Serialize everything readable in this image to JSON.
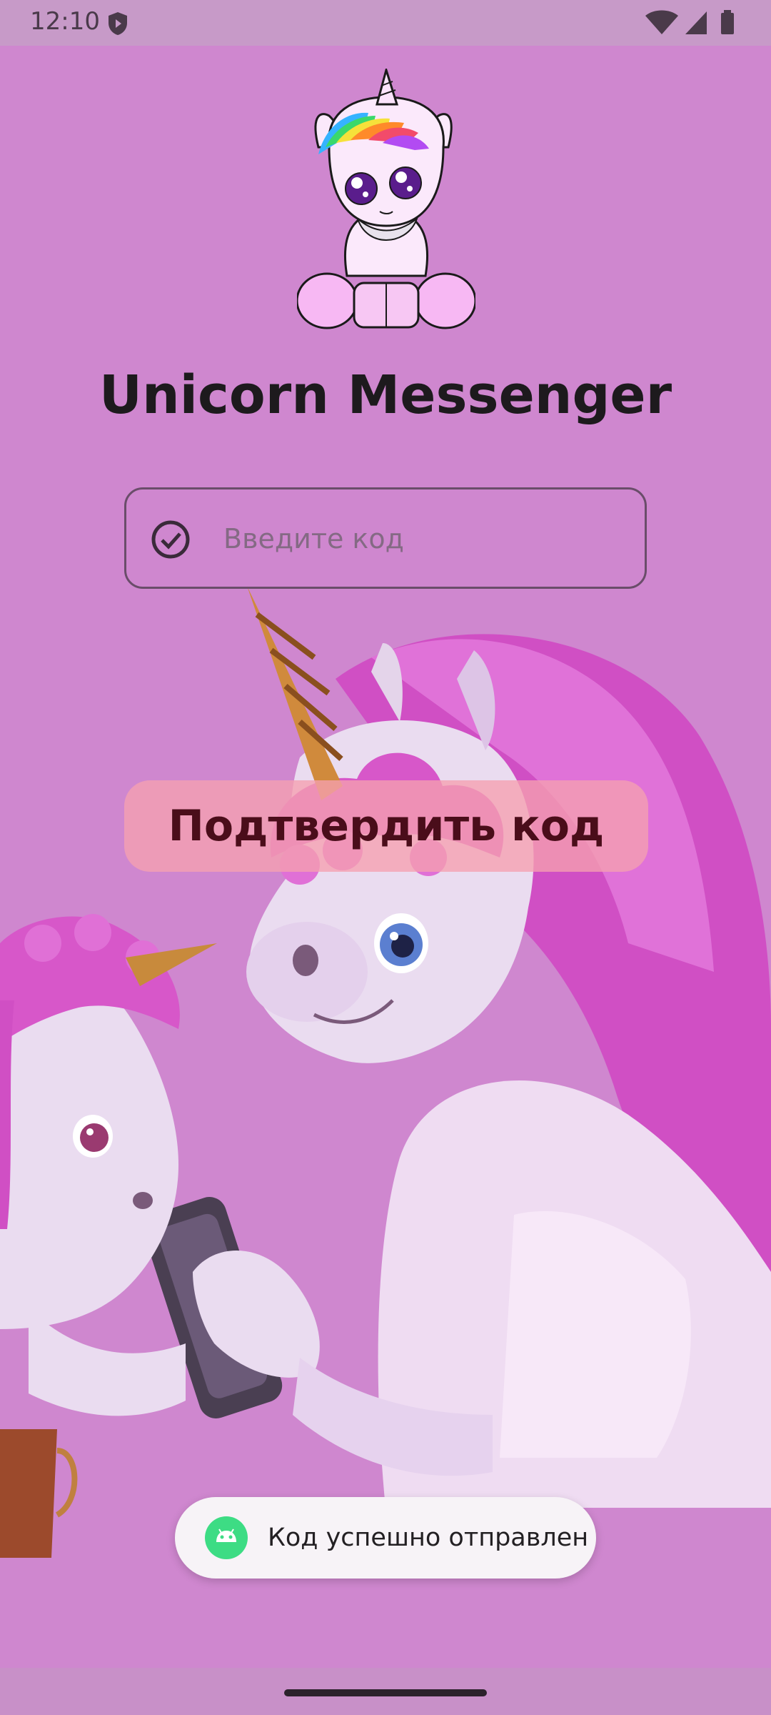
{
  "status_bar": {
    "time": "12:10",
    "icons": [
      "shield-icon",
      "wifi-icon",
      "signal-icon",
      "battery-icon"
    ]
  },
  "app": {
    "title": "Unicorn Messenger"
  },
  "code_input": {
    "placeholder": "Введите код",
    "value": "",
    "icon": "check-circle-icon"
  },
  "confirm_button": {
    "label": "Подтвердить код"
  },
  "toast": {
    "icon": "android-icon",
    "message": "Код успешно отправлен"
  },
  "colors": {
    "background": "#cf87cf",
    "button": "#f5a0af",
    "button_text": "#4a0d1a",
    "title": "#1d1a1d"
  }
}
